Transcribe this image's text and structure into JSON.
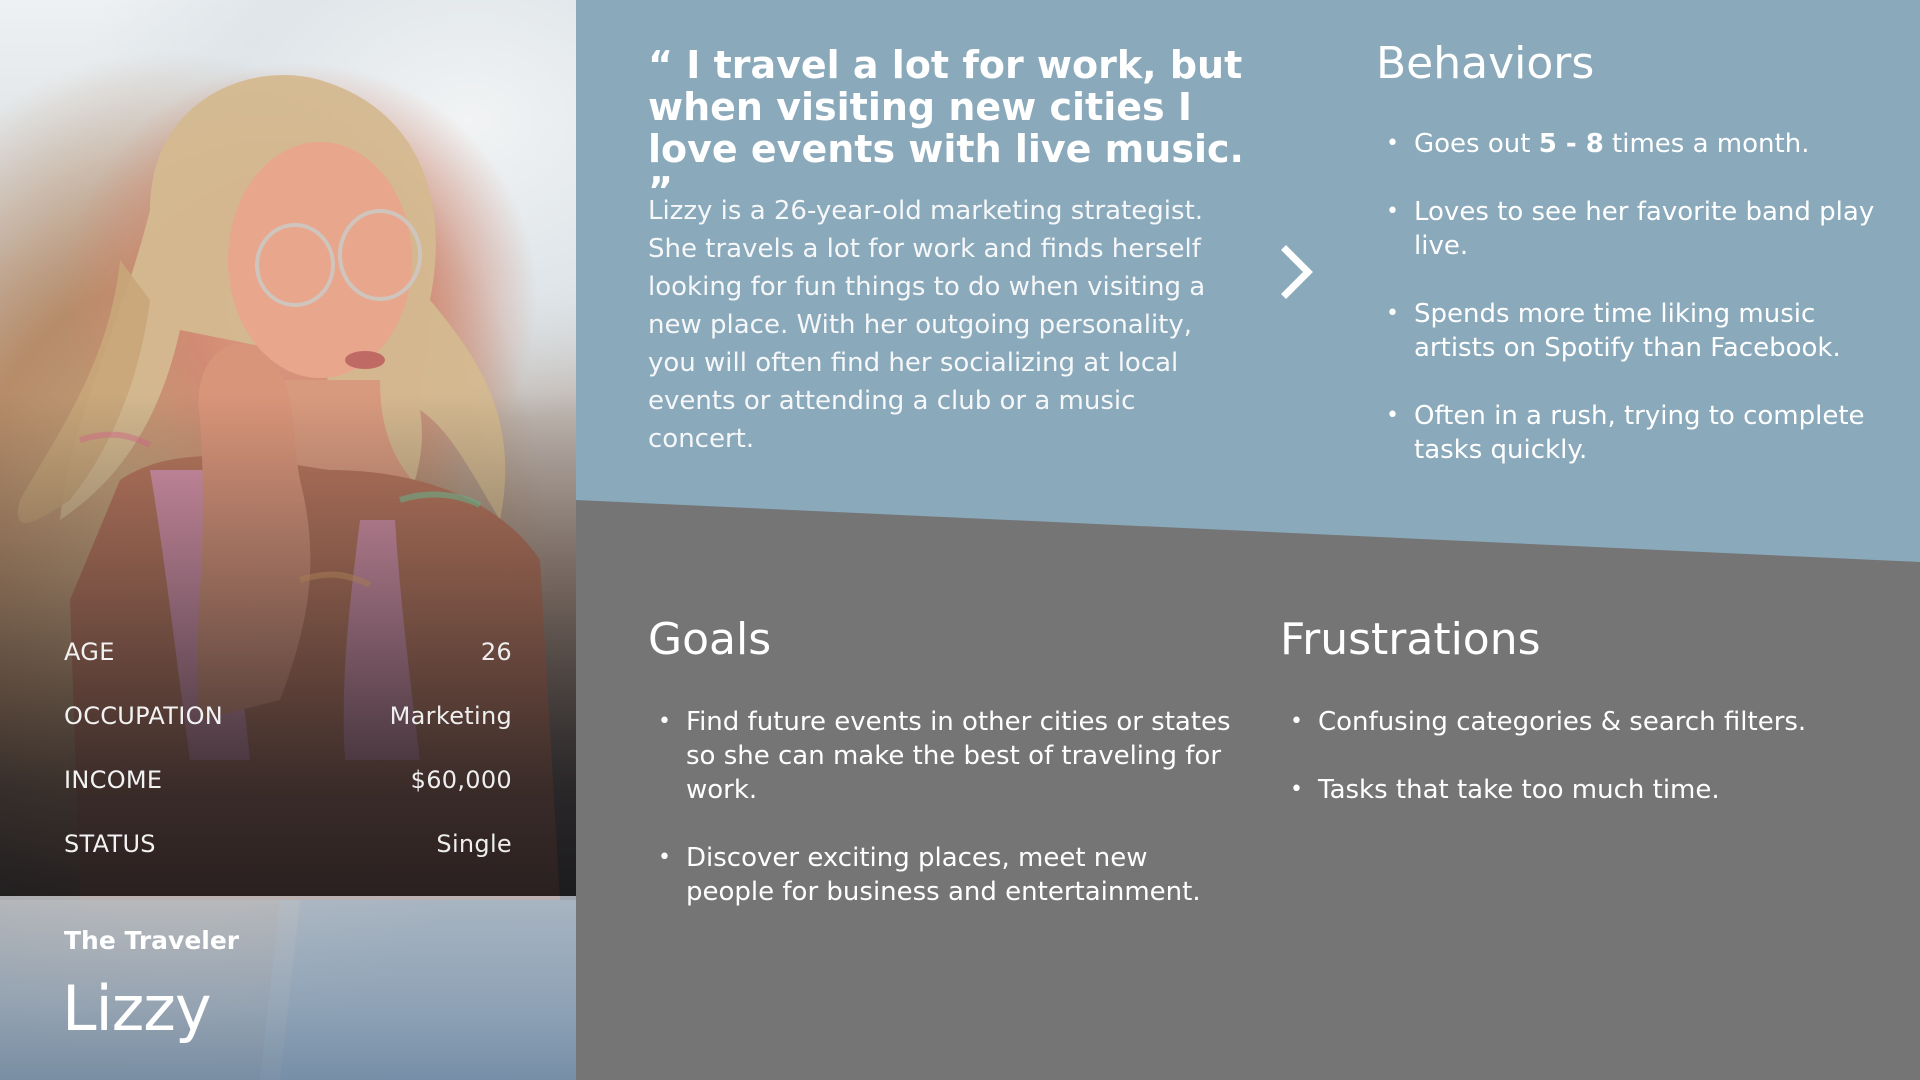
{
  "persona": {
    "type": "The Traveler",
    "name": "Lizzy",
    "stats": [
      {
        "label": "AGE",
        "value": "26"
      },
      {
        "label": "OCCUPATION",
        "value": "Marketing"
      },
      {
        "label": "INCOME",
        "value": "$60,000"
      },
      {
        "label": "STATUS",
        "value": "Single"
      }
    ]
  },
  "quote": "“ I travel a lot for work, but when visiting new cities I love events with live music. ”",
  "bio": "Lizzy is a 26-year-old marketing strategist. She travels a lot for work and finds herself looking for fun things to do when visiting a new place. With her outgoing personality, you will often find her socializing at local events or attending a club or a music concert.",
  "behaviors": {
    "title": "Behaviors",
    "items": [
      {
        "pre": "Goes out ",
        "bold": "5 - 8",
        "post": " times a month."
      },
      {
        "pre": "Loves to see her favorite band play live.",
        "bold": "",
        "post": ""
      },
      {
        "pre": "Spends more time liking music artists on Spotify than Facebook.",
        "bold": "",
        "post": ""
      },
      {
        "pre": "Often in a rush, trying to complete tasks quickly.",
        "bold": "",
        "post": ""
      }
    ]
  },
  "goals": {
    "title": "Goals",
    "items": [
      "Find future events in other cities or states so she can make the best of traveling for work.",
      "Discover exciting places, meet new people for business and entertainment."
    ]
  },
  "frustrations": {
    "title": "Frustrations",
    "items": [
      "Confusing categories & search filters.",
      "Tasks that take too much time."
    ]
  },
  "icons": {
    "next": "chevron-right-icon",
    "bullet": "•"
  },
  "colors": {
    "top_band": "#8aa9bb",
    "bottom_band": "#757575",
    "text": "#ffffff"
  }
}
